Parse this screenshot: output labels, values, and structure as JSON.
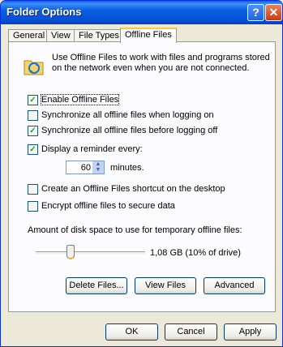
{
  "window": {
    "title": "Folder Options"
  },
  "titlebar": {
    "help_label": "?",
    "close_label": "✕"
  },
  "tabs": [
    {
      "label": "General"
    },
    {
      "label": "View"
    },
    {
      "label": "File Types"
    },
    {
      "label": "Offline Files"
    }
  ],
  "intro_text": "Use Offline Files to work with files and programs stored on the network even when you are not connected.",
  "checkboxes": [
    {
      "label": "Enable Offline Files",
      "checked": true
    },
    {
      "label": "Synchronize all offline files when logging on",
      "checked": false
    },
    {
      "label": "Synchronize all offline files before logging off",
      "checked": true
    },
    {
      "label": "Display a reminder every:",
      "checked": true
    }
  ],
  "reminder": {
    "value": "60",
    "unit_label": "minutes."
  },
  "checkboxes2": [
    {
      "label": "Create an Offline Files shortcut on the desktop",
      "checked": false
    },
    {
      "label": "Encrypt offline files to secure data",
      "checked": false
    }
  ],
  "disk": {
    "label": "Amount of disk space to use for temporary offline files:",
    "value_text": "1,08 GB (10% of drive)",
    "fraction": 0.1
  },
  "panel_buttons": {
    "delete": "Delete Files...",
    "view": "View Files",
    "advanced": "Advanced"
  },
  "footer_buttons": {
    "ok": "OK",
    "cancel": "Cancel",
    "apply": "Apply"
  },
  "colors": {
    "titlebar": "#0a5fe6",
    "face": "#ece9d8",
    "check": "#21a121"
  }
}
